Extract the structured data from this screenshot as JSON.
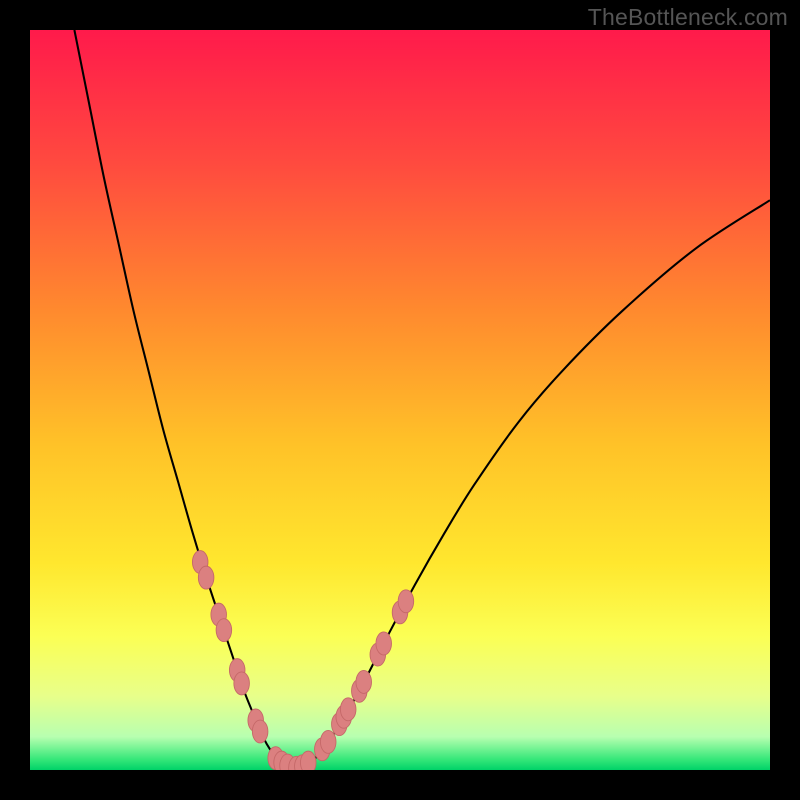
{
  "watermark": "TheBottleneck.com",
  "colors": {
    "frame": "#000000",
    "curve_stroke": "#000000",
    "bead_fill": "#db8080",
    "bead_stroke": "#c56868",
    "gradient_stops": [
      {
        "offset": 0.0,
        "color": "#ff1a4b"
      },
      {
        "offset": 0.18,
        "color": "#ff4a3f"
      },
      {
        "offset": 0.38,
        "color": "#ff8a2e"
      },
      {
        "offset": 0.56,
        "color": "#ffc228"
      },
      {
        "offset": 0.72,
        "color": "#ffe72e"
      },
      {
        "offset": 0.82,
        "color": "#fbff55"
      },
      {
        "offset": 0.9,
        "color": "#e8ff8a"
      },
      {
        "offset": 0.955,
        "color": "#b8ffb0"
      },
      {
        "offset": 0.985,
        "color": "#38e87a"
      },
      {
        "offset": 1.0,
        "color": "#00d268"
      }
    ]
  },
  "chart_data": {
    "type": "line",
    "title": "",
    "xlabel": "",
    "ylabel": "",
    "xlim": [
      0,
      100
    ],
    "ylim": [
      0,
      100
    ],
    "series": [
      {
        "name": "bottleneck-curve",
        "x": [
          6,
          8,
          10,
          12,
          14,
          16,
          18,
          20,
          22,
          24,
          26,
          28,
          29,
          30,
          31,
          32,
          33,
          34,
          35,
          36,
          38,
          40,
          44,
          48,
          52,
          56,
          60,
          66,
          72,
          80,
          90,
          100
        ],
        "y": [
          100,
          90,
          80,
          71,
          62,
          54,
          46,
          39,
          32,
          25.5,
          19.5,
          13.5,
          10.5,
          8,
          5.5,
          3.5,
          2,
          1,
          0.4,
          0.3,
          1.2,
          3.3,
          9.8,
          17.5,
          25,
          32,
          38.5,
          47,
          54,
          62,
          70.5,
          77
        ]
      }
    ],
    "beads": {
      "comment": "pink bead markers along the curve near the valley",
      "points": [
        {
          "x": 23.0,
          "y": 28.1
        },
        {
          "x": 23.8,
          "y": 26.0
        },
        {
          "x": 25.5,
          "y": 21.0
        },
        {
          "x": 26.2,
          "y": 18.9
        },
        {
          "x": 28.0,
          "y": 13.5
        },
        {
          "x": 28.6,
          "y": 11.7
        },
        {
          "x": 30.5,
          "y": 6.7
        },
        {
          "x": 31.1,
          "y": 5.2
        },
        {
          "x": 33.2,
          "y": 1.6
        },
        {
          "x": 34.0,
          "y": 1.0
        },
        {
          "x": 34.8,
          "y": 0.6
        },
        {
          "x": 36.0,
          "y": 0.3
        },
        {
          "x": 36.8,
          "y": 0.5
        },
        {
          "x": 37.6,
          "y": 1.0
        },
        {
          "x": 39.5,
          "y": 2.8
        },
        {
          "x": 40.3,
          "y": 3.8
        },
        {
          "x": 41.8,
          "y": 6.2
        },
        {
          "x": 42.4,
          "y": 7.2
        },
        {
          "x": 43.0,
          "y": 8.2
        },
        {
          "x": 44.5,
          "y": 10.7
        },
        {
          "x": 45.1,
          "y": 11.9
        },
        {
          "x": 47.0,
          "y": 15.6
        },
        {
          "x": 47.8,
          "y": 17.1
        },
        {
          "x": 50.0,
          "y": 21.3
        },
        {
          "x": 50.8,
          "y": 22.8
        }
      ],
      "rx": 1.05,
      "ry": 1.55
    }
  }
}
